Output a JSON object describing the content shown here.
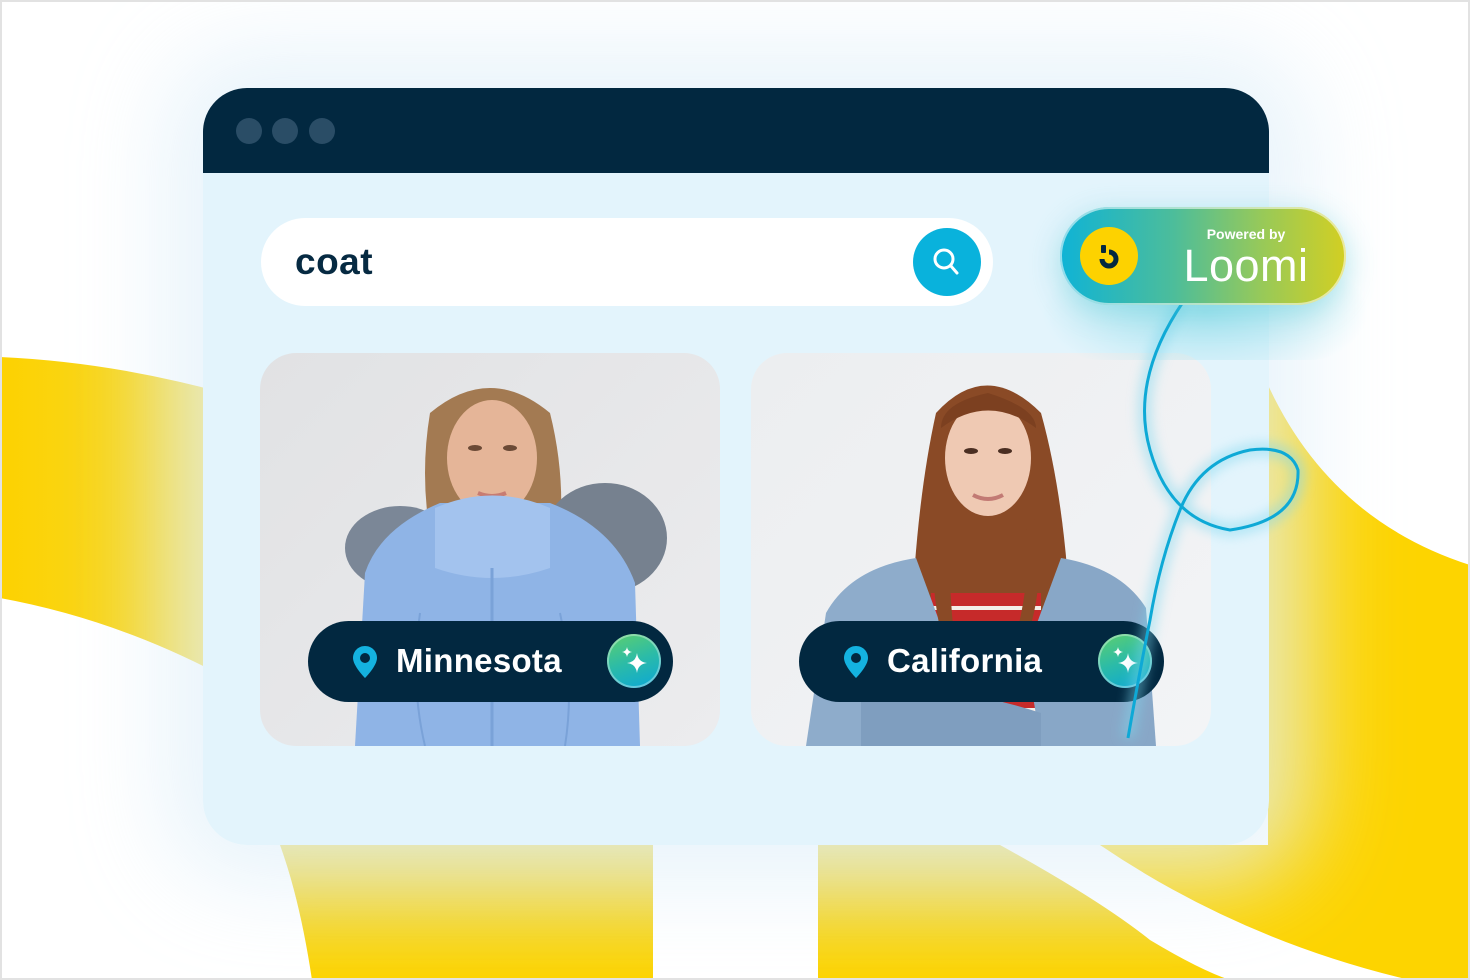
{
  "colors": {
    "brand_yellow": "#FDD200",
    "navy": "#022840",
    "accent_blue": "#09B2DC",
    "panel_bg": "#E3F4FC",
    "loomi_gradient": [
      "#0FB3D6",
      "#96C95A",
      "#D3CF22"
    ]
  },
  "browser": {
    "window_dots": [
      "dot",
      "dot",
      "dot"
    ]
  },
  "search": {
    "query": "coat",
    "icon": "search-icon"
  },
  "results": [
    {
      "image_description": "Woman wearing a light blue winter parka with a grey fur-trimmed hood",
      "location": "Minnesota",
      "location_icon": "map-pin-icon",
      "action_icon": "sparkles-icon"
    },
    {
      "image_description": "Young woman in a denim jacket over a red and white striped top, arms crossed",
      "location": "California",
      "location_icon": "map-pin-icon",
      "action_icon": "sparkles-icon"
    }
  ],
  "badge": {
    "powered_by": "Powered by",
    "brand": "Loomi",
    "logo_icon": "bloomreach-b-icon"
  }
}
